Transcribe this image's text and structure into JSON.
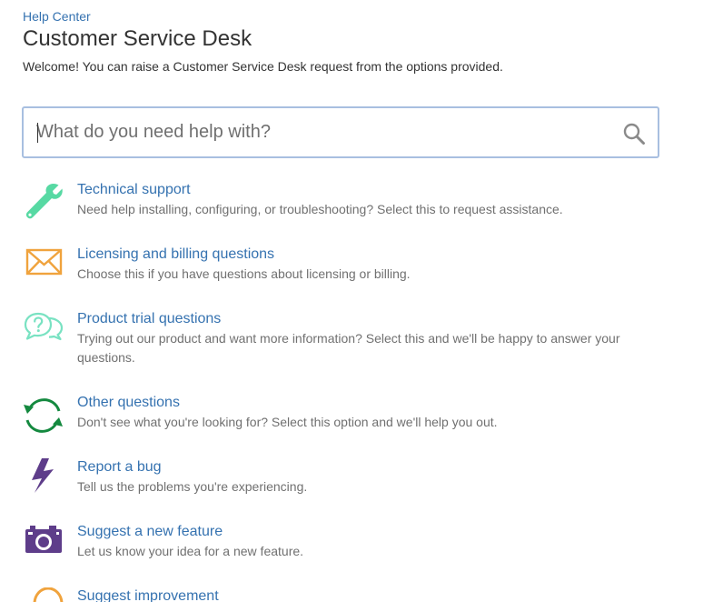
{
  "breadcrumb": {
    "label": "Help Center"
  },
  "page": {
    "title": "Customer Service Desk",
    "welcome": "Welcome! You can raise a Customer Service Desk request from the options provided."
  },
  "search": {
    "placeholder": "What do you need help with?",
    "value": ""
  },
  "request_types": [
    {
      "title": "Technical support",
      "description": "Need help installing, configuring, or troubleshooting? Select this to request assistance.",
      "icon": "wrench-icon",
      "color": "#57d9a3"
    },
    {
      "title": "Licensing and billing questions",
      "description": "Choose this if you have questions about licensing or billing.",
      "icon": "envelope-icon",
      "color": "#f0a33d"
    },
    {
      "title": "Product trial questions",
      "description": "Trying out our product and want more information? Select this and we'll be happy to answer your questions.",
      "icon": "question-bubbles-icon",
      "color": "#79e2c2"
    },
    {
      "title": "Other questions",
      "description": "Don't see what you're looking for? Select this option and we'll help you out.",
      "icon": "refresh-arrows-icon",
      "color": "#14893f"
    },
    {
      "title": "Report a bug",
      "description": "Tell us the problems you're experiencing.",
      "icon": "lightning-icon",
      "color": "#5e3d8a"
    },
    {
      "title": "Suggest a new feature",
      "description": "Let us know your idea for a new feature.",
      "icon": "camera-icon",
      "color": "#5e3d8a"
    },
    {
      "title": "Suggest improvement",
      "description": "",
      "icon": "lightbulb-icon",
      "color": "#f0a33d"
    }
  ]
}
